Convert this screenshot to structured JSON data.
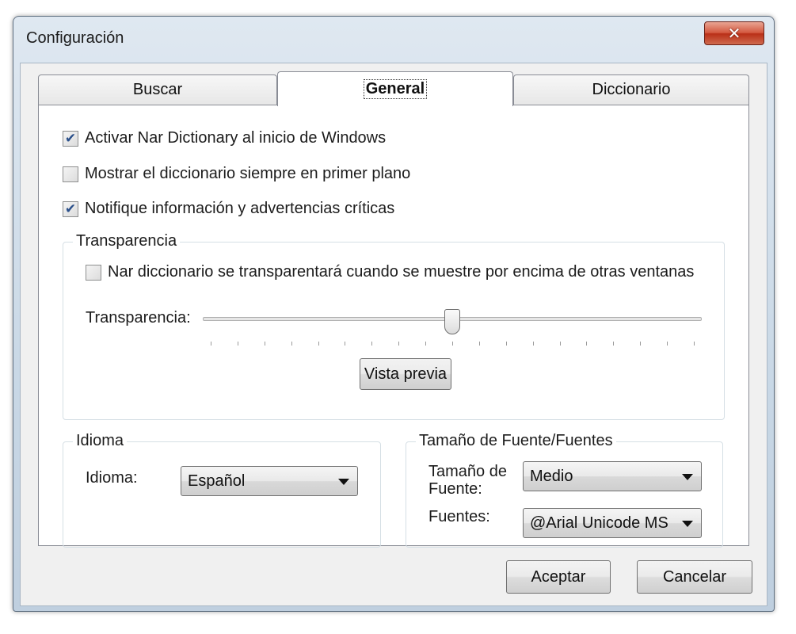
{
  "window": {
    "title": "Configuración",
    "close_symbol": "✕"
  },
  "tabs": [
    {
      "label": "Buscar"
    },
    {
      "label": "General"
    },
    {
      "label": "Diccionario"
    }
  ],
  "general": {
    "checks": [
      {
        "label": "Activar Nar Dictionary al inicio de Windows",
        "checked": true
      },
      {
        "label": "Mostrar el diccionario siempre en primer plano",
        "checked": false
      },
      {
        "label": "Notifique información y advertencias críticas",
        "checked": true
      }
    ],
    "transparency": {
      "group_label": "Transparencia",
      "check_label": "Nar diccionario se transparentará cuando se muestre por encima de otras ventanas",
      "check_checked": false,
      "slider_label": "Transparencia:",
      "slider_value_fraction": 0.5,
      "preview_button": "Vista previa"
    },
    "language": {
      "group_label": "Idioma",
      "label": "Idioma:",
      "value": "Español"
    },
    "font": {
      "group_label": "Tamaño de Fuente/Fuentes",
      "size_label_line1": "Tamaño de",
      "size_label_line2": "Fuente:",
      "size_value": "Medio",
      "fonts_label": "Fuentes:",
      "fonts_value": "@Arial Unicode MS"
    }
  },
  "buttons": {
    "ok": "Aceptar",
    "cancel": "Cancelar"
  }
}
